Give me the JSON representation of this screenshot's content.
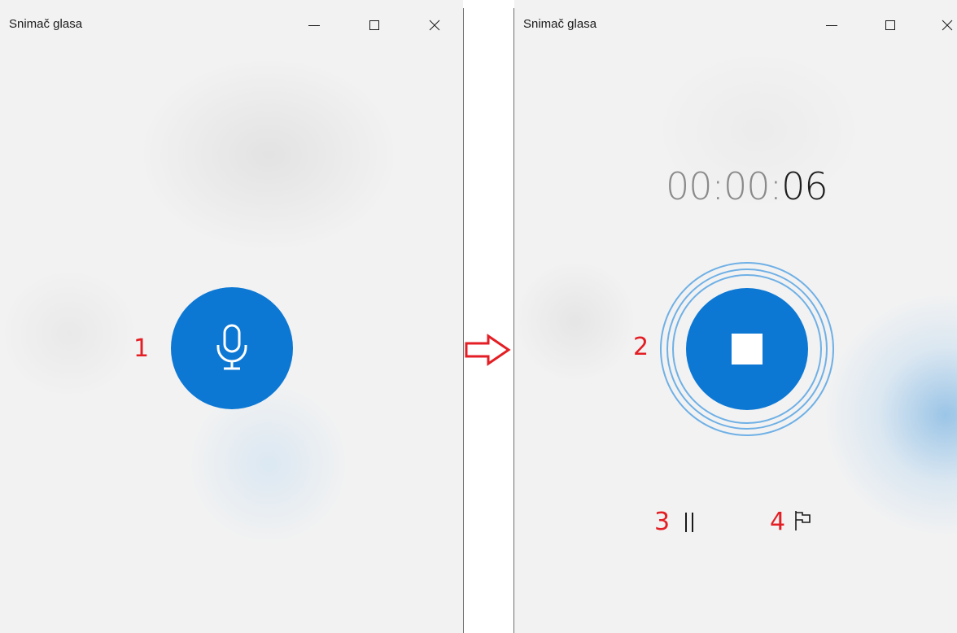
{
  "left_window": {
    "title": "Snimač glasa",
    "record_button": {
      "icon": "microphone-icon"
    },
    "annotation": "1"
  },
  "right_window": {
    "title": "Snimač glasa",
    "timer": {
      "prefix": "00:00:",
      "seconds": "06"
    },
    "stop_button": {
      "icon": "stop-icon"
    },
    "pause_button": {
      "icon": "pause-icon"
    },
    "marker_button": {
      "icon": "flag-icon"
    },
    "annotations": {
      "stop": "2",
      "pause": "3",
      "marker": "4"
    }
  },
  "titlebar_controls": {
    "minimize": "minimize-icon",
    "maximize": "maximize-icon",
    "close": "close-icon"
  },
  "transition_arrow": {
    "icon": "arrow-right-icon",
    "color": "#e31e24"
  },
  "colors": {
    "accent": "#0c78d4",
    "ring": "#6fb0e6",
    "annotation": "#e31e24",
    "background": "#f2f2f2"
  }
}
